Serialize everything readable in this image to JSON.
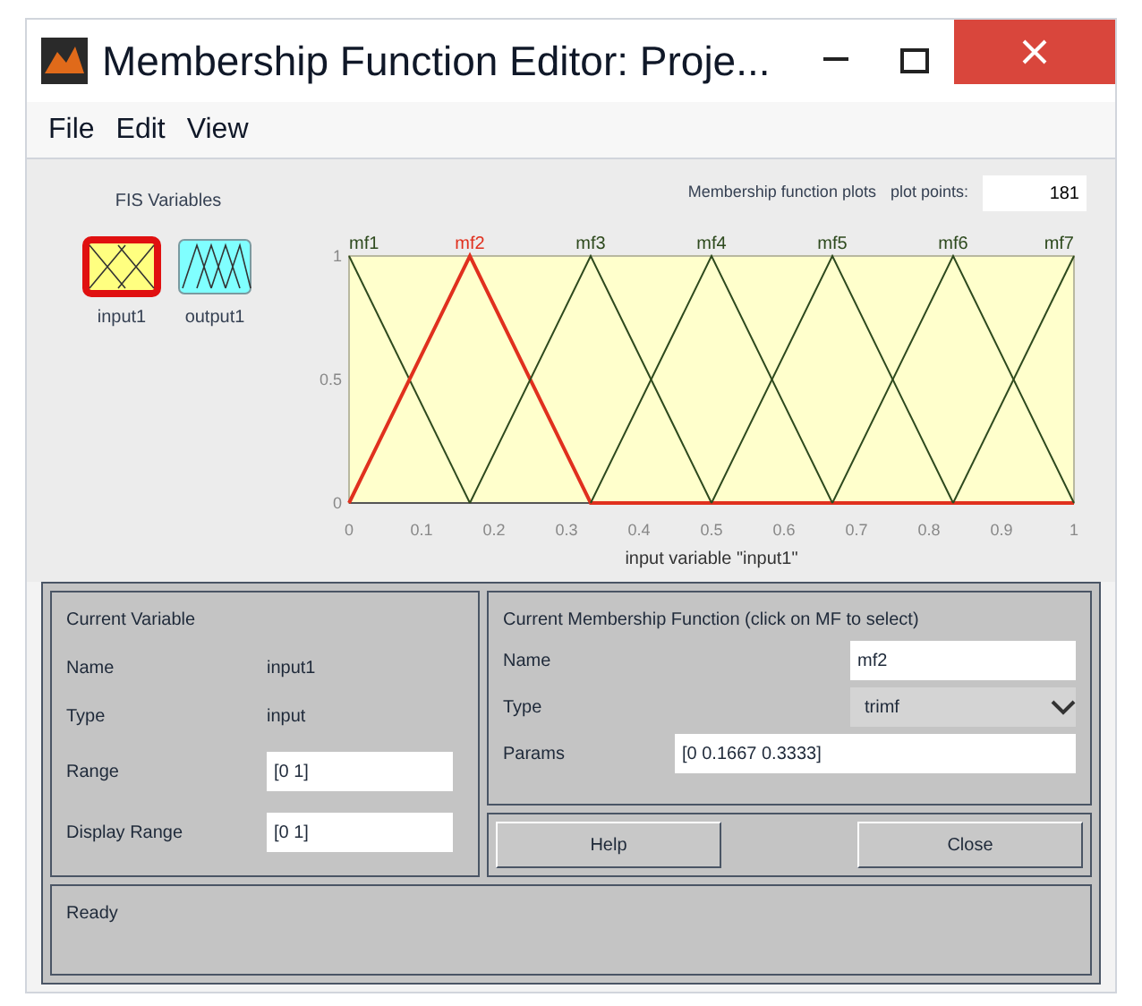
{
  "window": {
    "title": "Membership Function Editor: Proje..."
  },
  "menu": [
    "File",
    "Edit",
    "View"
  ],
  "fis_variables": {
    "title": "FIS Variables",
    "items": [
      {
        "label": "input1",
        "kind": "input",
        "selected": true,
        "color": "#ffff80"
      },
      {
        "label": "output1",
        "kind": "output",
        "selected": false,
        "color": "#80ffff"
      }
    ]
  },
  "plot_header": {
    "title": "Membership function plots",
    "plot_points_label": "plot points:",
    "plot_points": "181"
  },
  "chart_data": {
    "type": "line",
    "xlabel": "input variable \"input1\"",
    "x": [
      0,
      0.1667,
      0.3333,
      0.5,
      0.6667,
      0.8333,
      1
    ],
    "series": [
      {
        "name": "mf1",
        "color": "#2e4a1e",
        "values": [
          1,
          0,
          null,
          null,
          null,
          null,
          null
        ]
      },
      {
        "name": "mf2",
        "color": "#e0301e",
        "values": [
          0,
          1,
          0,
          0,
          0,
          0,
          0
        ]
      },
      {
        "name": "mf3",
        "color": "#2e4a1e",
        "values": [
          null,
          0,
          1,
          0,
          null,
          null,
          null
        ]
      },
      {
        "name": "mf4",
        "color": "#2e4a1e",
        "values": [
          null,
          null,
          0,
          1,
          0,
          null,
          null
        ]
      },
      {
        "name": "mf5",
        "color": "#2e4a1e",
        "values": [
          null,
          null,
          null,
          0,
          1,
          0,
          null
        ]
      },
      {
        "name": "mf6",
        "color": "#2e4a1e",
        "values": [
          null,
          null,
          null,
          null,
          0,
          1,
          0
        ]
      },
      {
        "name": "mf7",
        "color": "#2e4a1e",
        "values": [
          null,
          null,
          null,
          null,
          null,
          0,
          1
        ]
      }
    ],
    "xlim": [
      0,
      1
    ],
    "ylim": [
      0,
      1
    ],
    "xticks": [
      {
        "value": 0,
        "label": "0"
      },
      {
        "value": 0.1,
        "label": "0.1"
      },
      {
        "value": 0.2,
        "label": "0.2"
      },
      {
        "value": 0.3,
        "label": "0.3"
      },
      {
        "value": 0.4,
        "label": "0.4"
      },
      {
        "value": 0.5,
        "label": "0.5"
      },
      {
        "value": 0.6,
        "label": "0.6"
      },
      {
        "value": 0.7,
        "label": "0.7"
      },
      {
        "value": 0.8,
        "label": "0.8"
      },
      {
        "value": 0.9,
        "label": "0.9"
      },
      {
        "value": 1,
        "label": "1"
      }
    ],
    "yticks": [
      {
        "value": 0,
        "label": "0"
      },
      {
        "value": 0.5,
        "label": "0.5"
      },
      {
        "value": 1,
        "label": "1"
      }
    ]
  },
  "current_variable": {
    "title": "Current Variable",
    "name_label": "Name",
    "name": "input1",
    "type_label": "Type",
    "type": "input",
    "range_label": "Range",
    "range": "[0 1]",
    "display_range_label": "Display Range",
    "display_range": "[0 1]"
  },
  "current_mf": {
    "title": "Current Membership Function (click on MF to select)",
    "name_label": "Name",
    "name": "mf2",
    "type_label": "Type",
    "type": "trimf",
    "params_label": "Params",
    "params": "[0 0.1667 0.3333]"
  },
  "buttons": [
    "Help",
    "Close"
  ],
  "status": "Ready"
}
